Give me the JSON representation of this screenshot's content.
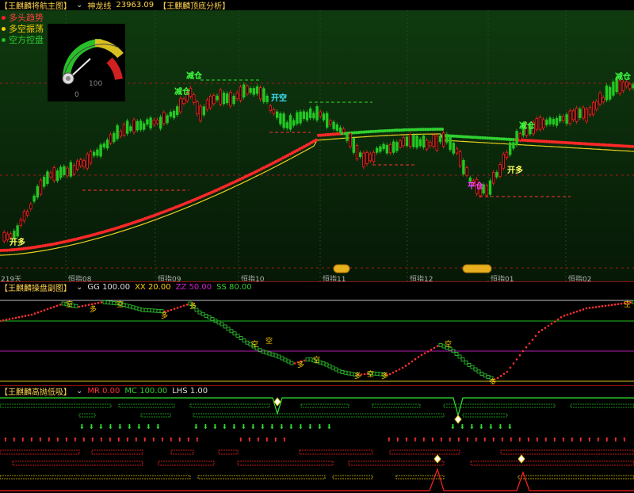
{
  "main_bar": {
    "title": "【王麒麟将航主图】",
    "indicator_label": "神龙线",
    "indicator_value": "23963.09",
    "title2": "【王麒麟顶底分析】"
  },
  "legend": [
    {
      "label": "多头趋势",
      "color": "#ff2020"
    },
    {
      "label": "多空振荡",
      "color": "#ffd000"
    },
    {
      "label": "空方控盘",
      "color": "#20c020"
    }
  ],
  "gauge": {
    "min_label": "0",
    "max_label": "100"
  },
  "xaxis": {
    "start_label": "219天",
    "months": [
      "恒指08",
      "恒指09",
      "恒指10",
      "恒指11",
      "恒指12",
      "恒指01",
      "恒指02"
    ]
  },
  "annotations": {
    "buy1": "开多",
    "reduce1": "减仓",
    "reduce2": "减仓",
    "open_short": "开空",
    "cover": "平仓",
    "buy2": "开多",
    "reduce3": "减仓",
    "reduce4": "减仓"
  },
  "sub1_bar": {
    "title": "【王麒麟操盘副图】",
    "gg": "GG 100.00",
    "xx": "XX 20.00",
    "zz": "ZZ 50.00",
    "ss": "SS 80.00"
  },
  "sub1_marks": [
    "空",
    "多",
    "空",
    "多",
    "多",
    "空",
    "空",
    "多",
    "空",
    "多",
    "空",
    "多",
    "空",
    "多",
    "空"
  ],
  "sub2_bar": {
    "title": "【王麒麟高抛低吸】",
    "mr": "MR 0.00",
    "mc": "MC 100.00",
    "lhs": "LHS 1.00"
  },
  "colors": {
    "up": "#ff2020",
    "down": "#20c020",
    "gold": "#ffd000",
    "magenta": "#d000d0",
    "cyan": "#20e0e0",
    "panel_bg": "#0b2a0b"
  }
}
